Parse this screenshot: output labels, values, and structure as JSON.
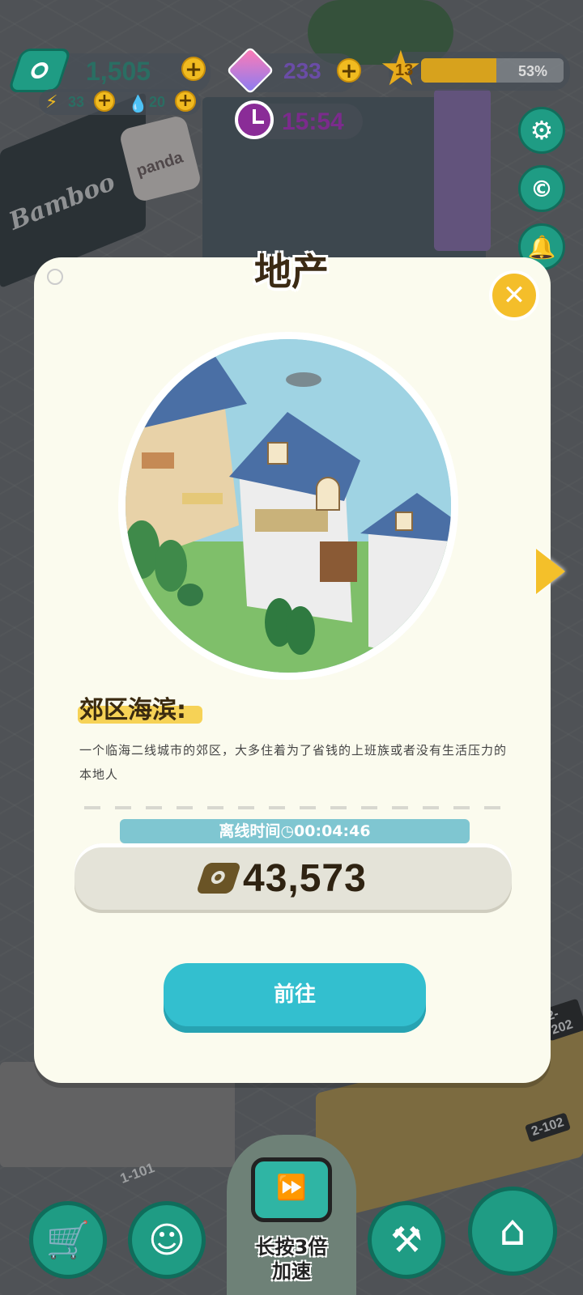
{
  "hud": {
    "cash": "1,505",
    "energy": "33",
    "water": "20",
    "gems": "233",
    "level": "13",
    "level_progress": 0.53,
    "level_progress_label": "53%",
    "clock": "15:54"
  },
  "background": {
    "sign_bamboo": "Bamboo",
    "sign_panda": "panda",
    "room_101": "1-101",
    "room_102": "2-102",
    "room_202": "2-202"
  },
  "modal": {
    "title": "地产",
    "location_name": "郊区海滨:",
    "description": "一个临海二线城市的郊区，大多住着为了省钱的上班族或者没有生活压力的本地人",
    "offline_label": "离线时间",
    "offline_time": "00:04:46",
    "earnings": "43,573",
    "go_button": "前往"
  },
  "bottom_bar": {
    "speed_line1": "长按3倍",
    "speed_line2": "加速"
  },
  "colors": {
    "teal_button": "#33bfcf",
    "gold": "#f4be2a",
    "green_ui": "#1f9c84",
    "modal_bg": "#fbfbee"
  }
}
